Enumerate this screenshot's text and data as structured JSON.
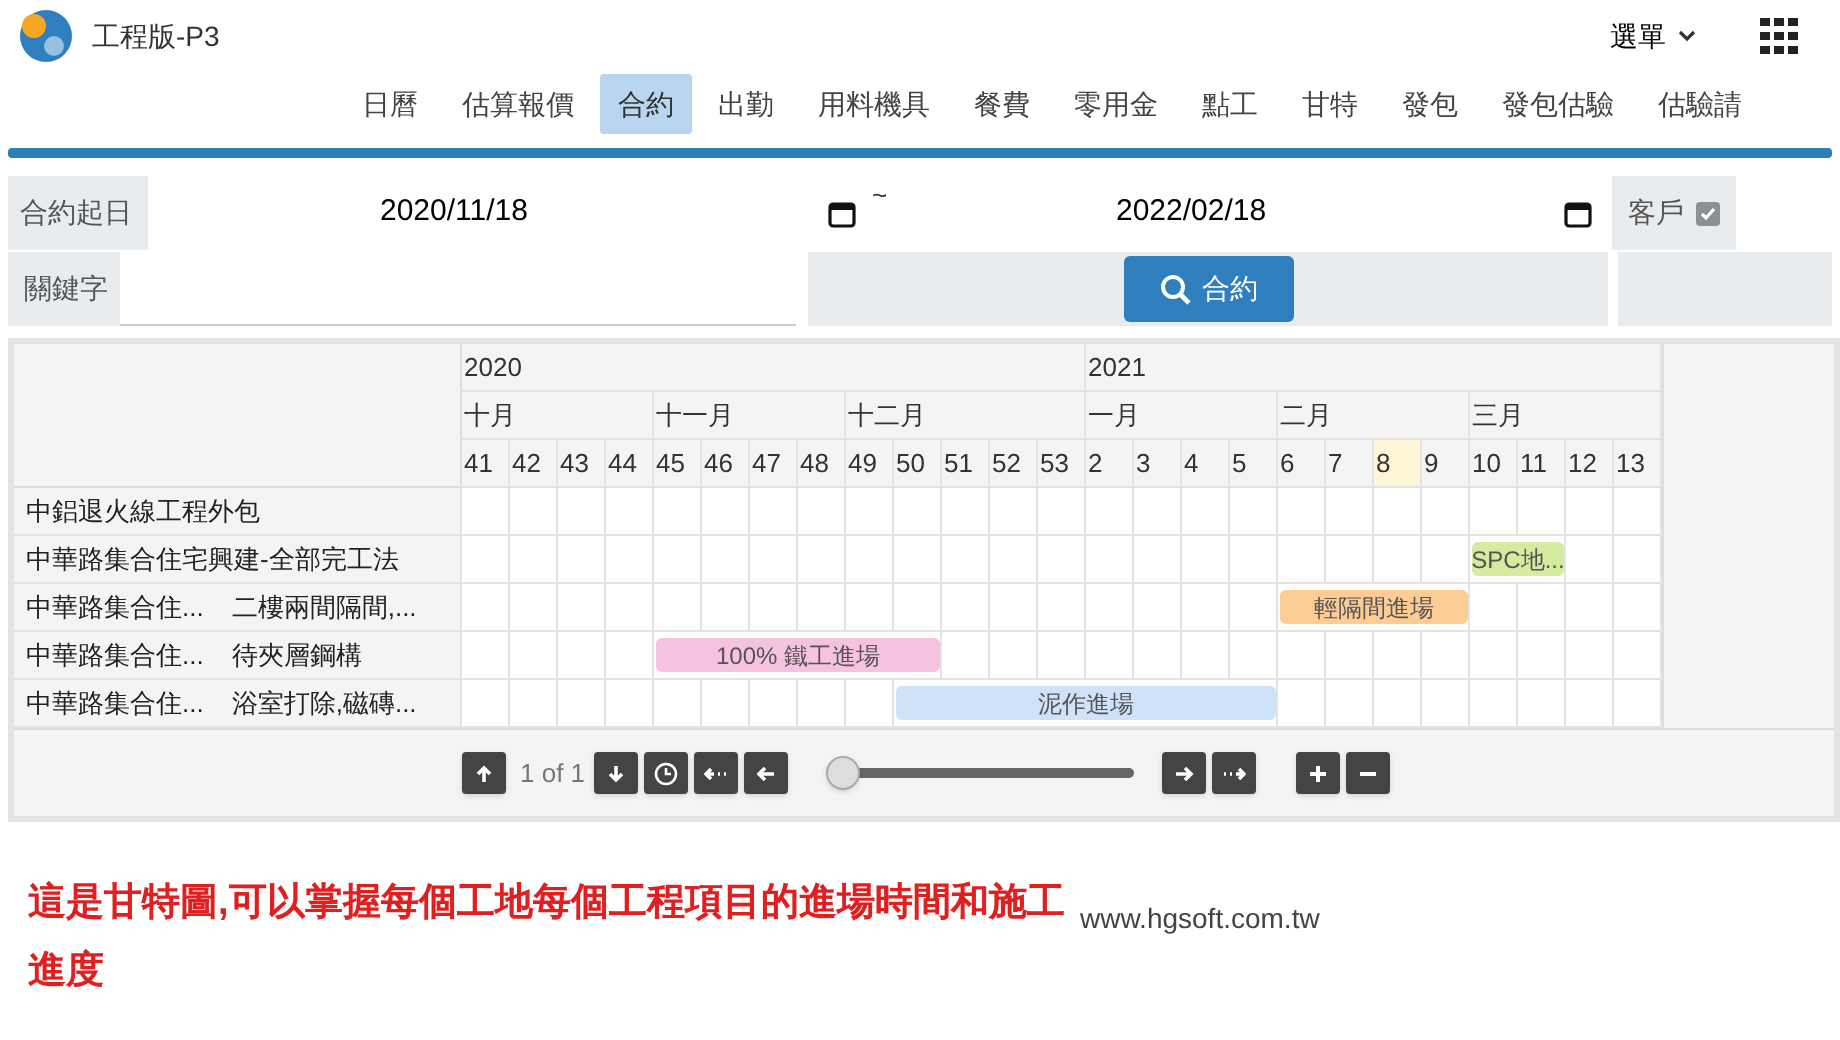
{
  "app": {
    "title": "工程版-P3",
    "menu": "選單"
  },
  "tabs": [
    {
      "label": "日曆",
      "selected": false
    },
    {
      "label": "估算報價",
      "selected": false
    },
    {
      "label": "合約",
      "selected": true
    },
    {
      "label": "出勤",
      "selected": false
    },
    {
      "label": "用料機具",
      "selected": false
    },
    {
      "label": "餐費",
      "selected": false
    },
    {
      "label": "零用金",
      "selected": false
    },
    {
      "label": "點工",
      "selected": false
    },
    {
      "label": "甘特",
      "selected": false
    },
    {
      "label": "發包",
      "selected": false
    },
    {
      "label": "發包估驗",
      "selected": false
    },
    {
      "label": "估驗請",
      "selected": false
    }
  ],
  "filters": {
    "start_label": "合約起日",
    "start_date": "2020/11/18",
    "range_sep": "~",
    "end_date": "2022/02/18",
    "customer_label": "客戶",
    "customer_checked": true,
    "keyword_label": "關鍵字",
    "search_button": "合約"
  },
  "gantt": {
    "years": [
      {
        "label": "2020",
        "months": [
          {
            "label": "十月",
            "weeks": [
              {
                "label": "41",
                "highlighted": false
              },
              {
                "label": "42",
                "highlighted": false
              },
              {
                "label": "43",
                "highlighted": false
              },
              {
                "label": "44",
                "highlighted": false
              }
            ]
          },
          {
            "label": "十一月",
            "weeks": [
              {
                "label": "45",
                "highlighted": false
              },
              {
                "label": "46",
                "highlighted": false
              },
              {
                "label": "47",
                "highlighted": false
              },
              {
                "label": "48",
                "highlighted": false
              }
            ]
          },
          {
            "label": "十二月",
            "weeks": [
              {
                "label": "49",
                "highlighted": false
              },
              {
                "label": "50",
                "highlighted": false
              },
              {
                "label": "51",
                "highlighted": false
              },
              {
                "label": "52",
                "highlighted": false
              },
              {
                "label": "53",
                "highlighted": false
              }
            ]
          }
        ]
      },
      {
        "label": "2021",
        "months": [
          {
            "label": "一月",
            "weeks": [
              {
                "label": "2",
                "highlighted": false
              },
              {
                "label": "3",
                "highlighted": false
              },
              {
                "label": "4",
                "highlighted": false
              },
              {
                "label": "5",
                "highlighted": false
              }
            ]
          },
          {
            "label": "二月",
            "weeks": [
              {
                "label": "6",
                "highlighted": false
              },
              {
                "label": "7",
                "highlighted": false
              },
              {
                "label": "8",
                "highlighted": true
              },
              {
                "label": "9",
                "highlighted": false
              }
            ]
          },
          {
            "label": "三月",
            "weeks": [
              {
                "label": "10",
                "highlighted": false
              },
              {
                "label": "11",
                "highlighted": false
              },
              {
                "label": "12",
                "highlighted": false
              },
              {
                "label": "13",
                "highlighted": false
              }
            ]
          }
        ]
      }
    ],
    "rows": [
      {
        "project": "中鋁退火線工程外包"
      },
      {
        "project": "中華路集合住宅興建-全部完工法",
        "bar": {
          "label": "SPC地...",
          "color": "#d4eba0"
        },
        "covered": [
          false,
          false,
          false,
          false,
          false,
          false,
          false,
          false,
          false,
          false,
          false,
          false,
          false,
          false,
          false,
          false,
          false,
          false,
          false,
          false,
          false,
          true,
          true,
          false,
          false
        ]
      },
      {
        "project": "中華路集合住...",
        "item": "二樓兩間隔間,...",
        "bar": {
          "label": "輕隔間進場",
          "color": "#fbcd94"
        },
        "covered": [
          false,
          false,
          false,
          false,
          false,
          false,
          false,
          false,
          false,
          false,
          false,
          false,
          false,
          false,
          false,
          false,
          false,
          true,
          true,
          true,
          true,
          false,
          false,
          false,
          false
        ]
      },
      {
        "project": "中華路集合住...",
        "item": "待夾層鋼構",
        "bar": {
          "label": "100% 鐵工進場",
          "color": "#f5c2e0"
        },
        "covered": [
          false,
          false,
          false,
          false,
          true,
          true,
          true,
          true,
          true,
          true,
          false,
          false,
          false,
          false,
          false,
          false,
          false,
          false,
          false,
          false,
          false,
          false,
          false,
          false,
          false
        ]
      },
      {
        "project": "中華路集合住...",
        "item": "浴室打除,磁磚...",
        "bar": {
          "label": "泥作進場",
          "color": "#cfe2f8"
        },
        "covered": [
          false,
          false,
          false,
          false,
          false,
          false,
          false,
          false,
          false,
          true,
          true,
          true,
          true,
          true,
          true,
          true,
          true,
          false,
          false,
          false,
          false,
          false,
          false,
          false,
          false
        ]
      }
    ],
    "pager": "1 of 1",
    "zoom_slider": {
      "level": 0
    }
  },
  "caption": "這是甘特圖,可以掌握每個工地每個工程項目的進場時間和施工進度",
  "website": "www.hgsoft.com.tw"
}
